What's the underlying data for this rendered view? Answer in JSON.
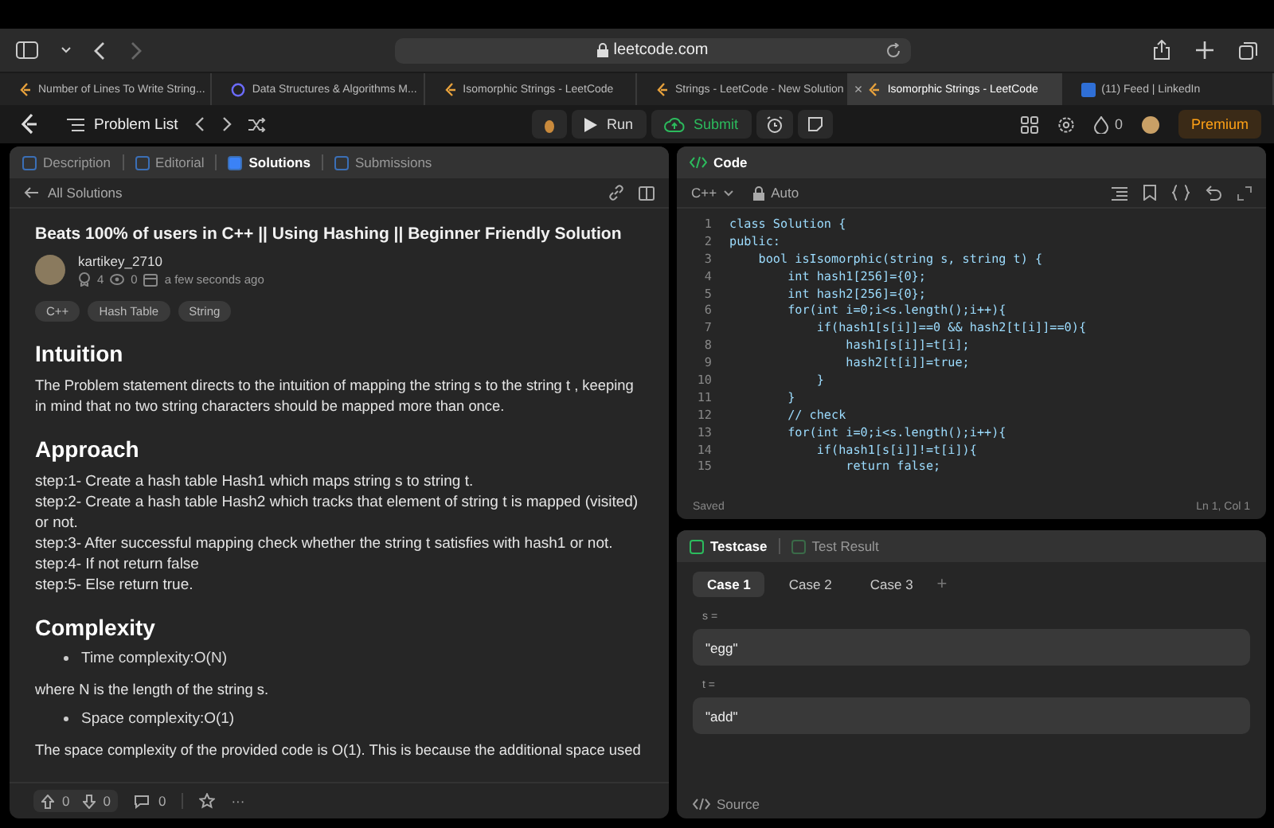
{
  "browser": {
    "address": "leetcode.com",
    "tabs": [
      {
        "title": "Number of Lines To Write String...",
        "selected": false,
        "kind": "lc"
      },
      {
        "title": "Data Structures & Algorithms M...",
        "selected": false,
        "kind": "ds"
      },
      {
        "title": "Isomorphic Strings - LeetCode",
        "selected": false,
        "kind": "lc"
      },
      {
        "title": "Strings - LeetCode - New Solution",
        "selected": false,
        "kind": "lc"
      },
      {
        "title": "Isomorphic Strings - LeetCode",
        "selected": true,
        "kind": "lc"
      },
      {
        "title": "(11) Feed | LinkedIn",
        "selected": false,
        "kind": "in"
      }
    ],
    "close": "×"
  },
  "nav": {
    "problem_list": "Problem List",
    "run": "Run",
    "submit": "Submit",
    "streak": "0",
    "premium": "Premium"
  },
  "left": {
    "tabs": [
      {
        "label": "Description",
        "selected": false
      },
      {
        "label": "Editorial",
        "selected": false
      },
      {
        "label": "Solutions",
        "selected": true
      },
      {
        "label": "Submissions",
        "selected": false
      }
    ],
    "back": "All Solutions",
    "post": {
      "title": "Beats 100% of users in C++ || Using Hashing || Beginner Friendly Solution",
      "author": "kartikey_2710",
      "upvotes": "4",
      "views": "0",
      "time": "a few seconds ago",
      "tags": [
        "C++",
        "Hash Table",
        "String"
      ],
      "blocks": [
        {
          "kind": "heading",
          "text": "Intuition"
        },
        {
          "kind": "para",
          "text": "The Problem statement directs to the intuition of mapping the string s to the string t , keeping in mind that no two string characters should be mapped more than once."
        },
        {
          "kind": "heading",
          "text": "Approach"
        },
        {
          "kind": "lines",
          "lines": [
            "step:1- Create a hash table Hash1 which maps string s to string t.",
            "step:2- Create a hash table Hash2 which tracks that element of string t is mapped (visited) or not.",
            "step:3- After successful mapping check whether the string t satisfies with hash1 or not.",
            "step:4- If not return false",
            "step:5- Else return true."
          ]
        },
        {
          "kind": "heading",
          "text": "Complexity"
        },
        {
          "kind": "bullet",
          "text": "Time complexity:O(N)"
        },
        {
          "kind": "para",
          "text": "where N is the length of the string s."
        },
        {
          "kind": "bullet",
          "text": "Space complexity:O(1)"
        },
        {
          "kind": "para",
          "text": "The space complexity of the provided code is O(1). This is because the additional space used"
        }
      ]
    },
    "footer": {
      "up": "0",
      "down": "0",
      "comments": "0",
      "more": "···"
    }
  },
  "code": {
    "title": "Code",
    "language": "C++",
    "mode": "Auto",
    "lines": [
      {
        "n": "1",
        "text": "class Solution {"
      },
      {
        "n": "2",
        "text": "public:"
      },
      {
        "n": "3",
        "text": "    bool isIsomorphic(string s, string t) {"
      },
      {
        "n": "4",
        "text": "        int hash1[256]={0};"
      },
      {
        "n": "5",
        "text": "        int hash2[256]={0};"
      },
      {
        "n": "6",
        "text": "        for(int i=0;i<s.length();i++){"
      },
      {
        "n": "7",
        "text": "            if(hash1[s[i]]==0 && hash2[t[i]]==0){"
      },
      {
        "n": "8",
        "text": "                hash1[s[i]]=t[i];"
      },
      {
        "n": "9",
        "text": "                hash2[t[i]]=true;"
      },
      {
        "n": "10",
        "text": "            }"
      },
      {
        "n": "11",
        "text": "        }"
      },
      {
        "n": "12",
        "text": "        // check"
      },
      {
        "n": "13",
        "text": "        for(int i=0;i<s.length();i++){"
      },
      {
        "n": "14",
        "text": "            if(hash1[s[i]]!=t[i]){"
      },
      {
        "n": "15",
        "text": "                return false;"
      }
    ],
    "status": "Saved",
    "position": "Ln 1, Col 1"
  },
  "tests": {
    "tabs": [
      {
        "label": "Testcase",
        "selected": true
      },
      {
        "label": "Test Result",
        "selected": false
      }
    ],
    "cases": [
      {
        "label": "Case 1",
        "selected": true
      },
      {
        "label": "Case 2",
        "selected": false
      },
      {
        "label": "Case 3",
        "selected": false
      }
    ],
    "add": "+",
    "inputs": [
      {
        "label": "s =",
        "value": "\"egg\""
      },
      {
        "label": "t =",
        "value": "\"add\""
      }
    ],
    "source": "Source"
  }
}
